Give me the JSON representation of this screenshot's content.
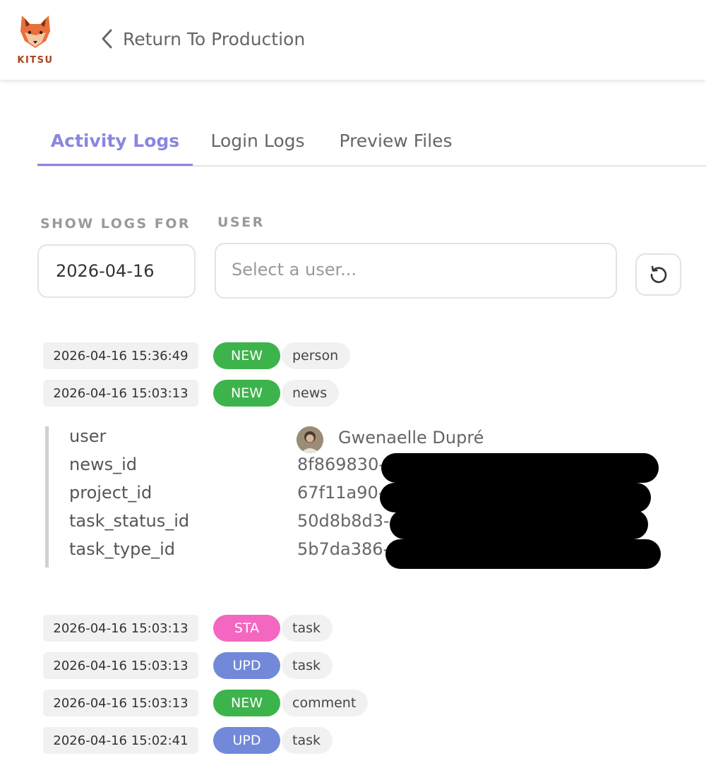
{
  "header": {
    "logo_text": "KITSU",
    "back_label": "Return To Production"
  },
  "tabs": [
    {
      "label": "Activity Logs",
      "active": true
    },
    {
      "label": "Login Logs",
      "active": false
    },
    {
      "label": "Preview Files",
      "active": false
    }
  ],
  "filters": {
    "show_logs_for_label": "SHOW LOGS FOR",
    "date_value": "2026-04-16",
    "user_label": "USER",
    "user_placeholder": "Select a user..."
  },
  "logs_before": [
    {
      "timestamp": "2026-04-16 15:36:49",
      "action": "NEW",
      "kind": "person",
      "color": "#3cb44b"
    },
    {
      "timestamp": "2026-04-16 15:03:13",
      "action": "NEW",
      "kind": "news",
      "color": "#3cb44b"
    }
  ],
  "detail": {
    "user_key": "user",
    "user_name": "Gwenaelle Dupré",
    "fields": [
      {
        "key": "news_id",
        "value": "8f869830-"
      },
      {
        "key": "project_id",
        "value": "67f11a90-"
      },
      {
        "key": "task_status_id",
        "value": "50d8b8d3-"
      },
      {
        "key": "task_type_id",
        "value": "5b7da386-"
      }
    ]
  },
  "logs_after": [
    {
      "timestamp": "2026-04-16 15:03:13",
      "action": "STA",
      "kind": "task",
      "color": "#f467c1"
    },
    {
      "timestamp": "2026-04-16 15:03:13",
      "action": "UPD",
      "kind": "task",
      "color": "#7289da"
    },
    {
      "timestamp": "2026-04-16 15:03:13",
      "action": "NEW",
      "kind": "comment",
      "color": "#3cb44b"
    },
    {
      "timestamp": "2026-04-16 15:02:41",
      "action": "UPD",
      "kind": "task",
      "color": "#7289da"
    }
  ],
  "colors": {
    "accent": "#8a86e0",
    "new": "#3cb44b",
    "status": "#f467c1",
    "update": "#7289da"
  }
}
